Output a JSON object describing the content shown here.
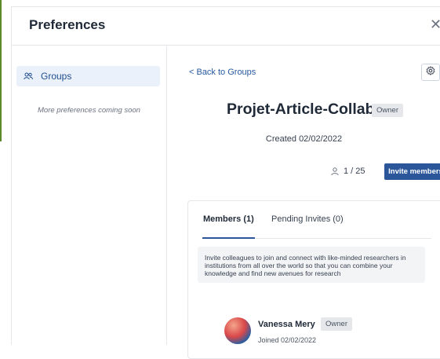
{
  "modal": {
    "title": "Preferences",
    "close_icon": "close-icon"
  },
  "sidebar": {
    "items": [
      {
        "label": "Groups",
        "icon": "users-icon",
        "selected": true
      }
    ],
    "more_note": "More preferences coming soon"
  },
  "group": {
    "back_label": "< Back to Groups",
    "settings_icon": "gear-icon",
    "name": "Projet-Article-Collab",
    "role_badge": "Owner",
    "created": "Created 02/02/2022",
    "member_count": "1 / 25",
    "invite_label": "Invite members"
  },
  "tabs": [
    {
      "label": "Members (1)",
      "active": true
    },
    {
      "label": "Pending Invites (0)",
      "active": false
    }
  ],
  "info_text": "Invite colleagues to join and connect with like-minded researchers in institutions from all over the world so that you can combine your knowledge and find new avenues for research",
  "members": [
    {
      "name": "Vanessa Mery",
      "role": "Owner",
      "joined": "Joined 02/02/2022"
    }
  ],
  "colors": {
    "accent": "#2b579a",
    "link": "#2858a0",
    "selected_bg": "#eaf1fb",
    "badge_bg": "#e5e7eb"
  }
}
